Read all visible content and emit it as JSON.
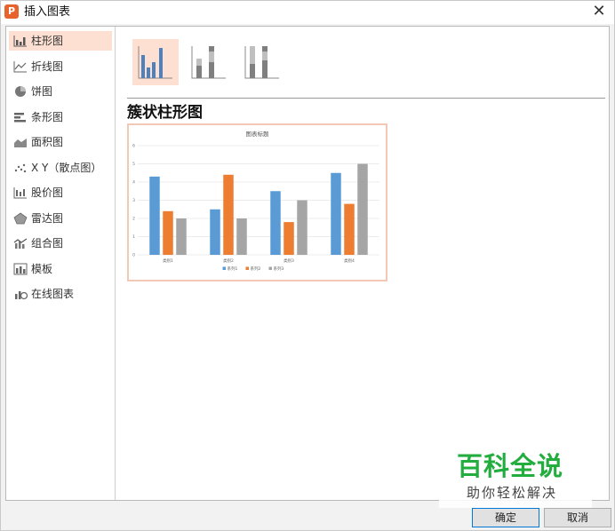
{
  "window": {
    "title": "插入图表",
    "app_icon_glyph": "P",
    "close_glyph": "✕"
  },
  "sidebar": {
    "items": [
      {
        "label": "柱形图",
        "icon": "column-chart-icon",
        "selected": true
      },
      {
        "label": "折线图",
        "icon": "line-chart-icon"
      },
      {
        "label": "饼图",
        "icon": "pie-chart-icon"
      },
      {
        "label": "条形图",
        "icon": "bar-chart-icon"
      },
      {
        "label": "面积图",
        "icon": "area-chart-icon"
      },
      {
        "label": "X Y（散点图）",
        "icon": "scatter-chart-icon"
      },
      {
        "label": "股价图",
        "icon": "stock-chart-icon"
      },
      {
        "label": "雷达图",
        "icon": "radar-chart-icon"
      },
      {
        "label": "组合图",
        "icon": "combo-chart-icon"
      },
      {
        "label": "模板",
        "icon": "template-icon"
      },
      {
        "label": "在线图表",
        "icon": "online-chart-icon"
      }
    ]
  },
  "subtypes": [
    {
      "name": "clustered-column",
      "selected": true
    },
    {
      "name": "stacked-column"
    },
    {
      "name": "percent-stacked-column"
    }
  ],
  "subtype_title": "簇状柱形图",
  "chart_data": {
    "type": "bar",
    "title": "图表标题",
    "categories": [
      "类别1",
      "类别2",
      "类别3",
      "类别4"
    ],
    "series": [
      {
        "name": "系列1",
        "values": [
          4.3,
          2.5,
          3.5,
          4.5
        ],
        "color": "#5b9bd5"
      },
      {
        "name": "系列2",
        "values": [
          2.4,
          4.4,
          1.8,
          2.8
        ],
        "color": "#ed7d31"
      },
      {
        "name": "系列3",
        "values": [
          2,
          2,
          3,
          5
        ],
        "color": "#a5a5a5"
      }
    ],
    "ylim": [
      0,
      6
    ],
    "yticks": [
      "0",
      "1",
      "2",
      "3",
      "4",
      "5",
      "6"
    ],
    "grid": true,
    "legend": "bottom"
  },
  "buttons": {
    "ok": "确定",
    "cancel": "取消"
  },
  "watermark": {
    "main": "百科全说",
    "sub": "助你轻松解决"
  },
  "colors": {
    "accent": "#e8632b",
    "selected_bg": "#fde0d2",
    "watermark_green": "#23ad3f"
  }
}
